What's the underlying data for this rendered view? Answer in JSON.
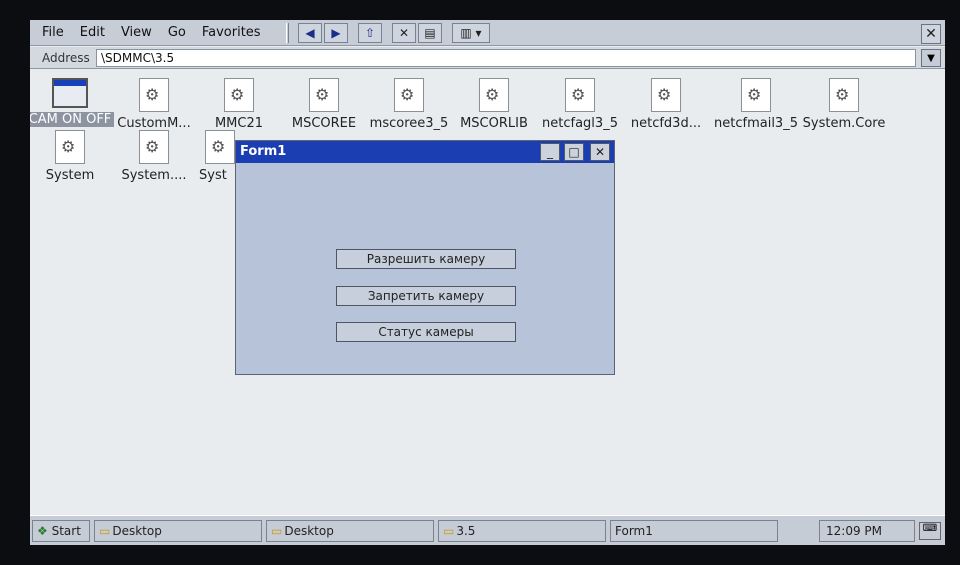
{
  "menu": [
    "File",
    "Edit",
    "View",
    "Go",
    "Favorites"
  ],
  "toolbar": {
    "back_icon": "back-arrow-icon",
    "forward_icon": "forward-arrow-icon",
    "up_icon": "folder-up-icon",
    "delete_icon": "delete-x-icon",
    "properties_icon": "properties-icon",
    "views_icon": "view-menu-icon",
    "close_label": "✕"
  },
  "address": {
    "label": "Address",
    "value": "\\SDMMC\\3.5"
  },
  "files": [
    {
      "label": "CAM ON OFF",
      "type": "app"
    },
    {
      "label": "CustomM...",
      "type": "dll"
    },
    {
      "label": "MMC21",
      "type": "dll"
    },
    {
      "label": "MSCOREE",
      "type": "dll"
    },
    {
      "label": "mscoree3_5",
      "type": "dll"
    },
    {
      "label": "MSCORLIB",
      "type": "dll"
    },
    {
      "label": "netcfagl3_5",
      "type": "dll"
    },
    {
      "label": "netcfd3d...",
      "type": "dll"
    },
    {
      "label": "netcfmail3_5",
      "type": "dll"
    },
    {
      "label": "System.Core",
      "type": "dll"
    },
    {
      "label": "System",
      "type": "dll"
    },
    {
      "label": "System....",
      "type": "dll"
    },
    {
      "label": "Syst",
      "type": "dll"
    }
  ],
  "form1": {
    "title": "Form1",
    "minimize": "_",
    "maximize": "□",
    "close": "✕",
    "buttons": [
      "Разрешить камеру",
      "Запретить камеру",
      "Статус камеры"
    ]
  },
  "taskbar": {
    "start": "Start",
    "items": [
      "Desktop",
      "Desktop",
      "3.5",
      "Form1"
    ],
    "clock": "12:09 PM"
  }
}
